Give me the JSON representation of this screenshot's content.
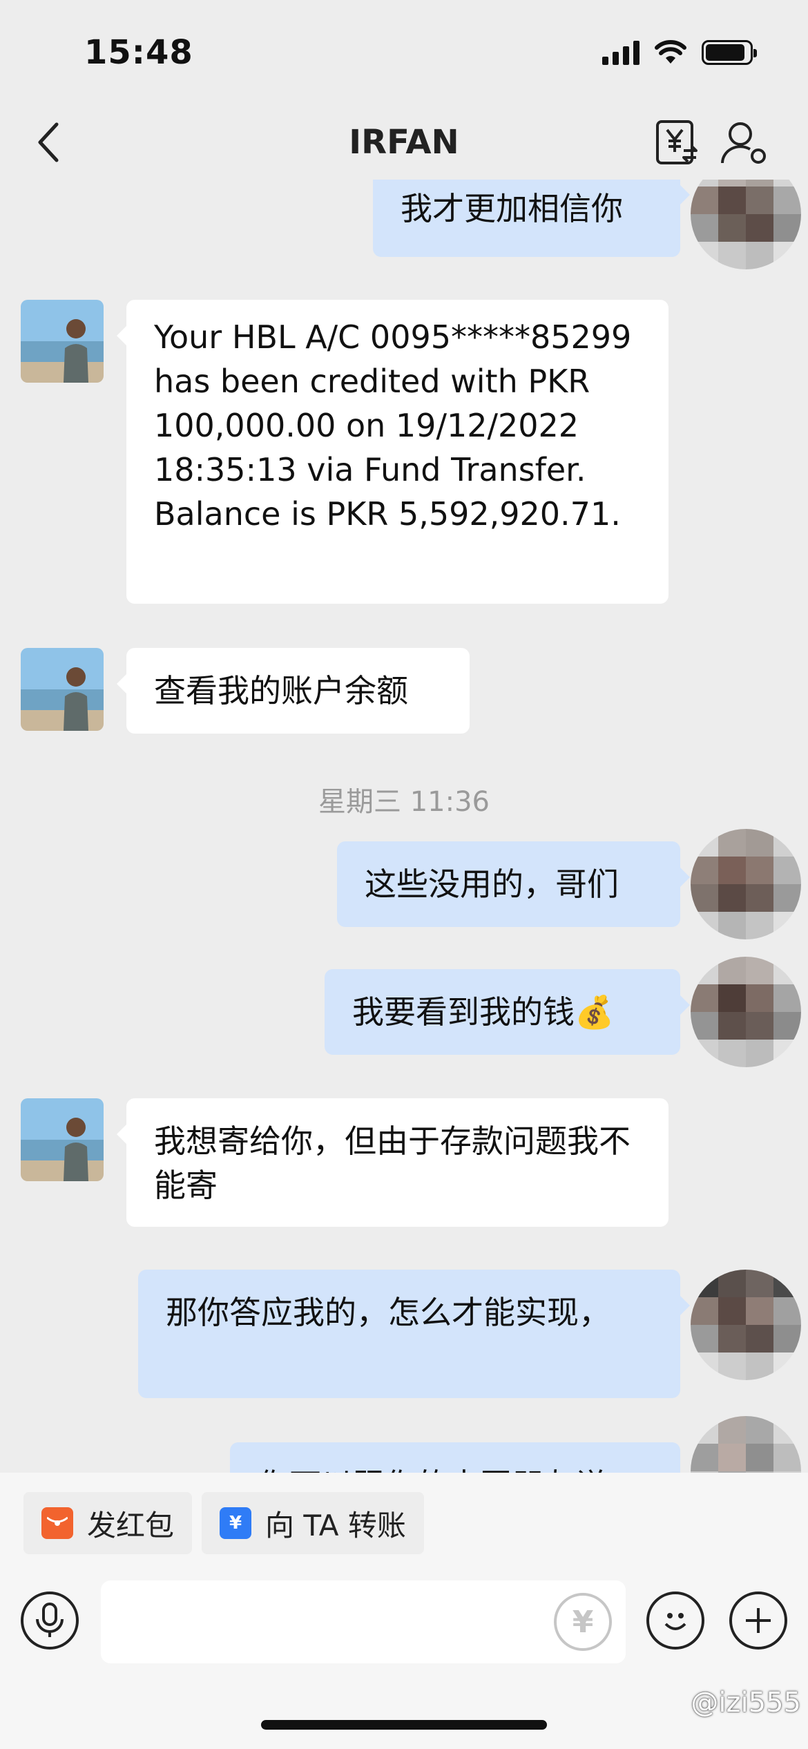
{
  "status_bar": {
    "time": "15:48",
    "battery_level": 0.9
  },
  "header": {
    "title": "IRFAN"
  },
  "messages": [
    {
      "side": "out",
      "text": "我才更加相信你"
    },
    {
      "side": "in",
      "text": "Your HBL A/C 0095*****85299 has been credited with PKR 100,000.00 on 19/12/2022 18:35:13 via Fund Transfer. Balance is PKR 5,592,920.71."
    },
    {
      "side": "in",
      "text": "查看我的账户余额"
    },
    {
      "type": "time",
      "text": "星期三 11:36"
    },
    {
      "side": "out",
      "text": "这些没用的，哥们"
    },
    {
      "side": "out",
      "text": "我要看到我的钱💰"
    },
    {
      "side": "in",
      "text": "我想寄给你，但由于存款问题我不能寄"
    },
    {
      "side": "out",
      "text": "那你答应我的，怎么才能实现，"
    },
    {
      "side": "out",
      "text": "你可以跟你的中国朋友说"
    }
  ],
  "quick_actions": [
    {
      "label": "发红包",
      "icon": "red-packet-icon",
      "color": "#f2632e"
    },
    {
      "label": "向 TA 转账",
      "icon": "transfer-yen-icon",
      "color": "#2f7cf6"
    }
  ],
  "input": {
    "placeholder": ""
  },
  "watermark": "@izi555",
  "colors": {
    "outgoing_bubble": "#d3e4fb",
    "incoming_bubble": "#ffffff",
    "background": "#ededed"
  }
}
